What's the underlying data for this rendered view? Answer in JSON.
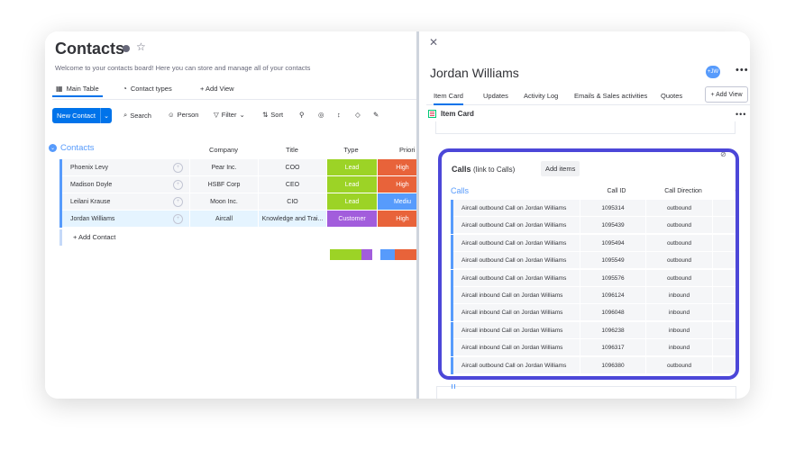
{
  "board": {
    "title": "Contacts",
    "description": "Welcome to your contacts board! Here you can store and manage all of your contacts",
    "views": [
      {
        "label": "Main Table"
      },
      {
        "label": "Contact types"
      },
      {
        "label": "+ Add View"
      }
    ],
    "toolbar": {
      "new_item": "New Contact",
      "search": "Search",
      "person": "Person",
      "filter": "Filter",
      "sort": "Sort"
    },
    "group": {
      "name": "Contacts",
      "columns": [
        "Company",
        "Title",
        "Type",
        "Priori"
      ],
      "rows": [
        {
          "name": "Phoenix Levy",
          "company": "Pear Inc.",
          "title": "COO",
          "type": "Lead",
          "priority": "High",
          "type_color": "#9cd326",
          "priority_color": "#e8633a"
        },
        {
          "name": "Madison Doyle",
          "company": "HSBF Corp",
          "title": "CEO",
          "type": "Lead",
          "priority": "High",
          "type_color": "#9cd326",
          "priority_color": "#e8633a"
        },
        {
          "name": "Leilani Krause",
          "company": "Moon Inc.",
          "title": "CIO",
          "type": "Lead",
          "priority": "Mediu",
          "type_color": "#9cd326",
          "priority_color": "#579bfc"
        },
        {
          "name": "Jordan Williams",
          "company": "Aircall",
          "title": "Knowledge and Trai...",
          "type": "Customer",
          "priority": "High",
          "type_color": "#a25ddc",
          "priority_color": "#e8633a"
        }
      ],
      "add_row": "+ Add Contact"
    }
  },
  "panel": {
    "name": "Jordan Williams",
    "avatar": "+JW",
    "tabs": [
      {
        "label": "Item Card"
      },
      {
        "label": "Updates"
      },
      {
        "label": "Activity Log"
      },
      {
        "label": "Emails & Sales activities"
      },
      {
        "label": "Quotes"
      }
    ],
    "add_view": "+ Add View",
    "item_card_label": "Item Card",
    "calls": {
      "title": "Calls",
      "subtitle": "(link to Calls)",
      "add_items": "Add items",
      "group_name": "Calls",
      "columns": [
        "Call ID",
        "Call Direction",
        "C"
      ],
      "rows": [
        {
          "name": "Aircall outbound Call on Jordan Williams",
          "id": "1095314",
          "direction": "outbound"
        },
        {
          "name": "Aircall outbound Call on Jordan Williams",
          "id": "1095439",
          "direction": "outbound"
        },
        {
          "name": "Aircall outbound Call on Jordan Williams",
          "id": "1095494",
          "direction": "outbound"
        },
        {
          "name": "Aircall outbound Call on Jordan Williams",
          "id": "1095549",
          "direction": "outbound"
        },
        {
          "name": "Aircall outbound Call on Jordan Williams",
          "id": "1095576",
          "direction": "outbound"
        },
        {
          "name": "Aircall inbound Call on Jordan Williams",
          "id": "1096124",
          "direction": "inbound"
        },
        {
          "name": "Aircall inbound Call on Jordan Williams",
          "id": "1096048",
          "direction": "inbound"
        },
        {
          "name": "Aircall inbound Call on Jordan Williams",
          "id": "1096238",
          "direction": "inbound"
        },
        {
          "name": "Aircall inbound Call on Jordan Williams",
          "id": "1096317",
          "direction": "inbound"
        },
        {
          "name": "Aircall outbound Call on Jordan Williams",
          "id": "1096380",
          "direction": "outbound"
        }
      ]
    }
  },
  "colors": {
    "accent": "#0073ea",
    "group_blue": "#579bfc",
    "highlight_frame": "#4c47d8"
  }
}
